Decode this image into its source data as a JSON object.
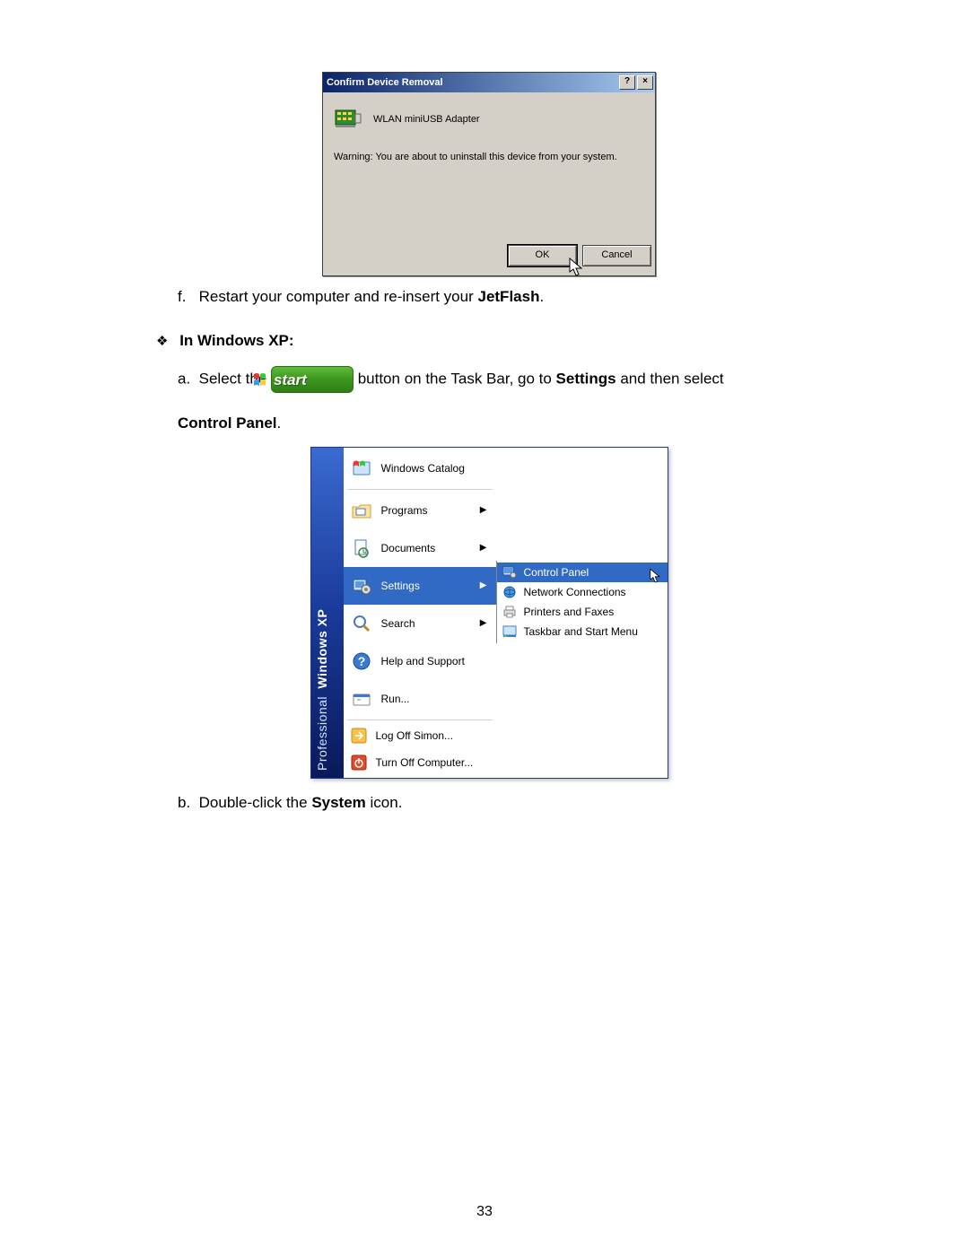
{
  "dialog": {
    "title": "Confirm Device Removal",
    "help_btn": "?",
    "close_btn": "×",
    "device_name": "WLAN miniUSB Adapter",
    "warning": "Warning: You are about to uninstall this device from your system.",
    "ok": "OK",
    "cancel": "Cancel"
  },
  "step_f": {
    "marker": "f.",
    "text_a": "Restart your computer and re-insert your ",
    "bold": "JetFlash",
    "text_b": "."
  },
  "section": {
    "bullet": "❖",
    "title": "In Windows XP:"
  },
  "step_a": {
    "marker": "a.",
    "pre": "Select the ",
    "start_label": "start",
    "post1": " button on the Task Bar, go to ",
    "bold1": "Settings",
    "post2": " and then select",
    "line2_bold": "Control Panel",
    "line2_tail": "."
  },
  "start_menu": {
    "sidebar_a": "Windows XP",
    "sidebar_b": "Professional",
    "items": [
      {
        "label": "Windows Catalog",
        "arrow": false
      },
      {
        "label": "Programs",
        "arrow": true
      },
      {
        "label": "Documents",
        "arrow": true
      },
      {
        "label": "Settings",
        "arrow": true,
        "highlight": true
      },
      {
        "label": "Search",
        "arrow": true
      },
      {
        "label": "Help and Support",
        "arrow": false
      },
      {
        "label": "Run...",
        "arrow": false
      }
    ],
    "items2": [
      {
        "label": "Log Off Simon..."
      },
      {
        "label": "Turn Off Computer..."
      }
    ],
    "submenu": [
      {
        "label": "Control Panel",
        "highlight": true
      },
      {
        "label": "Network Connections"
      },
      {
        "label": "Printers and Faxes"
      },
      {
        "label": "Taskbar and Start Menu"
      }
    ]
  },
  "step_b": {
    "marker": "b.",
    "pre": "Double-click the ",
    "bold": "System",
    "post": " icon."
  },
  "page_number": "33"
}
